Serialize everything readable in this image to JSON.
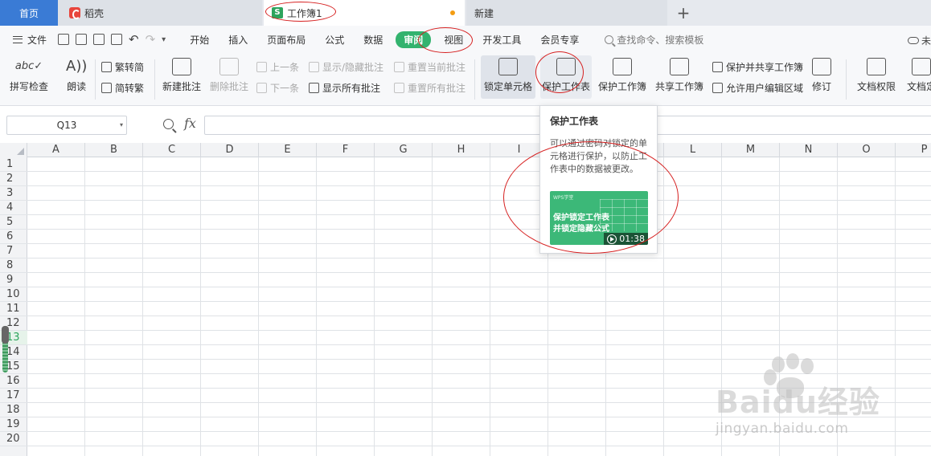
{
  "tabs": {
    "home": "首页",
    "daoke": "稻壳",
    "workbook": "工作簿1",
    "new": "新建",
    "add": "+"
  },
  "menu": {
    "file": "文件",
    "items": [
      "开始",
      "插入",
      "页面布局",
      "公式",
      "数据",
      "审阅",
      "视图",
      "开发工具",
      "会员专享"
    ],
    "active": "审阅",
    "search": "查找命令、搜索模板",
    "cloud": "未"
  },
  "toolbar": {
    "spellcheck": "拼写检查",
    "read_aloud": "朗读",
    "trad_to_simp": "繁转简",
    "simp_to_trad": "简转繁",
    "new_comment": "新建批注",
    "delete_comment": "删除批注",
    "prev": "上一条",
    "next": "下一条",
    "show_hide_comments": "显示/隐藏批注",
    "show_all_comments": "显示所有批注",
    "reset_current_comment": "重置当前批注",
    "reset_all_comments": "重置所有批注",
    "lock_cells": "锁定单元格",
    "protect_sheet": "保护工作表",
    "protect_workbook": "保护工作簿",
    "share_workbook": "共享工作簿",
    "protect_and_share": "保护并共享工作簿",
    "allow_edit_ranges": "允许用户编辑区域",
    "track_changes": "修订",
    "doc_permissions": "文档权限",
    "doc_finalize": "文档定"
  },
  "formula_bar": {
    "name_box": "Q13",
    "fx": "fx",
    "value": ""
  },
  "grid": {
    "columns": [
      "A",
      "B",
      "C",
      "D",
      "E",
      "F",
      "G",
      "H",
      "I",
      "J",
      "K",
      "L",
      "M",
      "N",
      "O",
      "P"
    ],
    "rows": [
      "1",
      "2",
      "3",
      "4",
      "5",
      "6",
      "7",
      "8",
      "9",
      "10",
      "11",
      "12",
      "13",
      "14",
      "15",
      "16",
      "17",
      "18",
      "19",
      "20"
    ],
    "active_row": "13"
  },
  "tooltip": {
    "title": "保护工作表",
    "description": "可以通过密码对锁定的单元格进行保护，以防止工作表中的数据被更改。",
    "video": {
      "brand": "WPS学堂",
      "line1": "保护锁定工作表",
      "line2": "并锁定隐藏公式",
      "duration": "01:38"
    }
  },
  "watermark": {
    "brand": "Baidu经验",
    "url": "jingyan.baidu.com"
  },
  "colors": {
    "accent_green": "#33b36e",
    "home_tab_blue": "#3a7bd5",
    "annotation_red": "#d62020"
  }
}
